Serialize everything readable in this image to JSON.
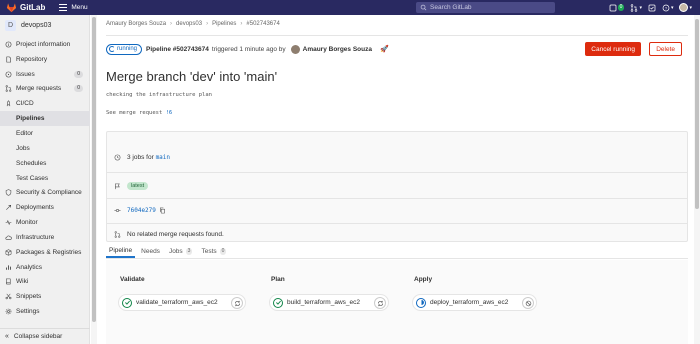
{
  "topbar": {
    "app_name": "GitLab",
    "menu_label": "Menu",
    "search_placeholder": "Search GitLab",
    "issues_count": "0"
  },
  "sidebar": {
    "project_initial": "D",
    "project_name": "devops03",
    "items": [
      {
        "label": "Project information",
        "icon": "info-icon"
      },
      {
        "label": "Repository",
        "icon": "doc-icon"
      },
      {
        "label": "Issues",
        "icon": "issues-icon",
        "badge": "0"
      },
      {
        "label": "Merge requests",
        "icon": "merge-request-icon",
        "badge": "0"
      },
      {
        "label": "CI/CD",
        "icon": "rocket-icon"
      },
      {
        "label": "Pipelines",
        "sub": true,
        "active": true
      },
      {
        "label": "Editor",
        "sub": true
      },
      {
        "label": "Jobs",
        "sub": true
      },
      {
        "label": "Schedules",
        "sub": true
      },
      {
        "label": "Test Cases",
        "sub": true
      },
      {
        "label": "Security & Compliance",
        "icon": "shield-icon"
      },
      {
        "label": "Deployments",
        "icon": "deployments-icon"
      },
      {
        "label": "Monitor",
        "icon": "monitor-icon"
      },
      {
        "label": "Infrastructure",
        "icon": "cloud-icon"
      },
      {
        "label": "Packages & Registries",
        "icon": "package-icon"
      },
      {
        "label": "Analytics",
        "icon": "chart-icon"
      },
      {
        "label": "Wiki",
        "icon": "book-icon"
      },
      {
        "label": "Snippets",
        "icon": "snippet-icon"
      },
      {
        "label": "Settings",
        "icon": "gear-icon"
      }
    ],
    "collapse_label": "Collapse sidebar"
  },
  "breadcrumb": [
    "Amaury Borges Souza",
    "devops03",
    "Pipelines",
    "#502743674"
  ],
  "header": {
    "status": "running",
    "pipeline_label": "Pipeline #502743674",
    "triggered_text": "triggered 1 minute ago by",
    "user_name": "Amaury Borges Souza",
    "cancel_label": "Cancel running",
    "delete_label": "Delete"
  },
  "title": "Merge branch 'dev' into 'main'",
  "description": "checking the infrastructure plan",
  "merge_request": {
    "prefix": "See merge request",
    "link": "!6"
  },
  "info": {
    "jobs_text": "3 jobs for",
    "branch": "main",
    "tag": "latest",
    "commit_sha": "7604e279",
    "related_mr_text": "No related merge requests found."
  },
  "tabs": [
    {
      "label": "Pipeline",
      "active": true
    },
    {
      "label": "Needs"
    },
    {
      "label": "Jobs",
      "count": "3"
    },
    {
      "label": "Tests",
      "count": "0"
    }
  ],
  "stages": [
    {
      "name": "Validate",
      "job": "validate_terraform_aws_ec2",
      "status": "success",
      "action": "retry-icon"
    },
    {
      "name": "Plan",
      "job": "build_terraform_aws_ec2",
      "status": "success",
      "action": "retry-icon"
    },
    {
      "name": "Apply",
      "job": "deploy_terraform_aws_ec2",
      "status": "running",
      "action": "cancel-icon"
    }
  ]
}
